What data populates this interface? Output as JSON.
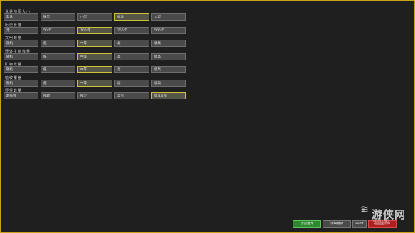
{
  "groups": [
    {
      "label": "世界地图大小",
      "options": [
        {
          "label": "默认",
          "selected": false
        },
        {
          "label": "微型",
          "selected": false
        },
        {
          "label": "小型",
          "selected": false
        },
        {
          "label": "标准",
          "selected": true
        },
        {
          "label": "大型",
          "selected": false
        }
      ]
    },
    {
      "label": "历史长度",
      "options": [
        {
          "label": "无",
          "selected": false
        },
        {
          "label": "50 年",
          "selected": false
        },
        {
          "label": "100 年",
          "selected": true
        },
        {
          "label": "250 年",
          "selected": false
        },
        {
          "label": "500 年",
          "selected": false
        }
      ]
    },
    {
      "label": "文明数量",
      "options": [
        {
          "label": "随机",
          "selected": false
        },
        {
          "label": "低",
          "selected": false
        },
        {
          "label": "中等",
          "selected": true
        },
        {
          "label": "高",
          "selected": false
        },
        {
          "label": "极高",
          "selected": false
        }
      ]
    },
    {
      "label": "野外生物数量",
      "options": [
        {
          "label": "随机",
          "selected": false
        },
        {
          "label": "低",
          "selected": false
        },
        {
          "label": "中等",
          "selected": true
        },
        {
          "label": "高",
          "selected": false
        },
        {
          "label": "极高",
          "selected": false
        }
      ]
    },
    {
      "label": "矿物数量",
      "options": [
        {
          "label": "随机",
          "selected": false
        },
        {
          "label": "低",
          "selected": false
        },
        {
          "label": "中等",
          "selected": true
        },
        {
          "label": "高",
          "selected": false
        },
        {
          "label": "极高",
          "selected": false
        }
      ]
    },
    {
      "label": "植被覆盖",
      "options": [
        {
          "label": "随机",
          "selected": false
        },
        {
          "label": "低",
          "selected": false
        },
        {
          "label": "中等",
          "selected": true
        },
        {
          "label": "高",
          "selected": false
        },
        {
          "label": "极高",
          "selected": false
        }
      ]
    },
    {
      "label": "野怪数量",
      "options": [
        {
          "label": "超低频",
          "selected": false
        },
        {
          "label": "稀疏",
          "selected": false
        },
        {
          "label": "稀少",
          "selected": false
        },
        {
          "label": "常见",
          "selected": false
        },
        {
          "label": "极其常见",
          "selected": true
        }
      ]
    }
  ],
  "footer": {
    "create_label": "创造世界",
    "mode_label": "详细模式",
    "info_label": "Pedit",
    "back_label": "返回主菜单"
  },
  "watermark": {
    "text": "游侠网",
    "url": "ALI213.NET"
  },
  "colors": {
    "border": "#c9a21a",
    "selected": "#cbc23a",
    "create": "#2e8a2e",
    "back": "#b02020"
  }
}
